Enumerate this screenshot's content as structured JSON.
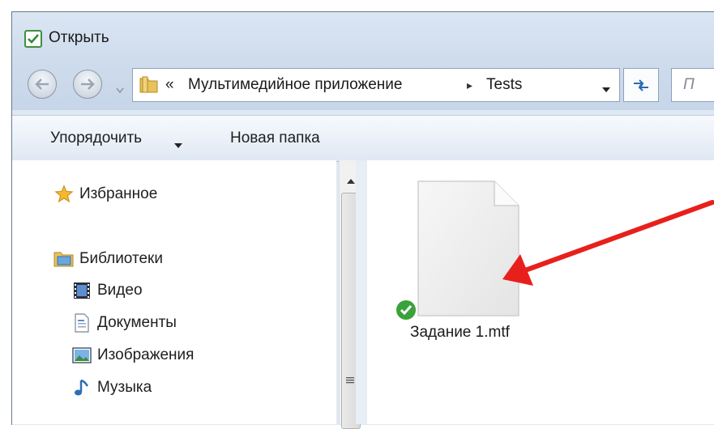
{
  "window": {
    "title": "Открыть"
  },
  "address": {
    "overflow": "«",
    "crumbs": [
      "Мультимедийное приложение",
      "Tests"
    ],
    "separator": "▸"
  },
  "search": {
    "placeholder": "П"
  },
  "toolbar": {
    "organize_label": "Упорядочить",
    "new_folder_label": "Новая папка"
  },
  "nav": {
    "favorites": "Избранное",
    "libraries": "Библиотеки",
    "items": [
      "Видео",
      "Документы",
      "Изображения",
      "Музыка"
    ]
  },
  "files": [
    {
      "name": "Задание 1.mtf",
      "status": "synced"
    }
  ],
  "colors": {
    "accent_arrow": "#e8201c",
    "status_ok": "#3aa23a",
    "window_chrome": "#dfe9f5"
  }
}
